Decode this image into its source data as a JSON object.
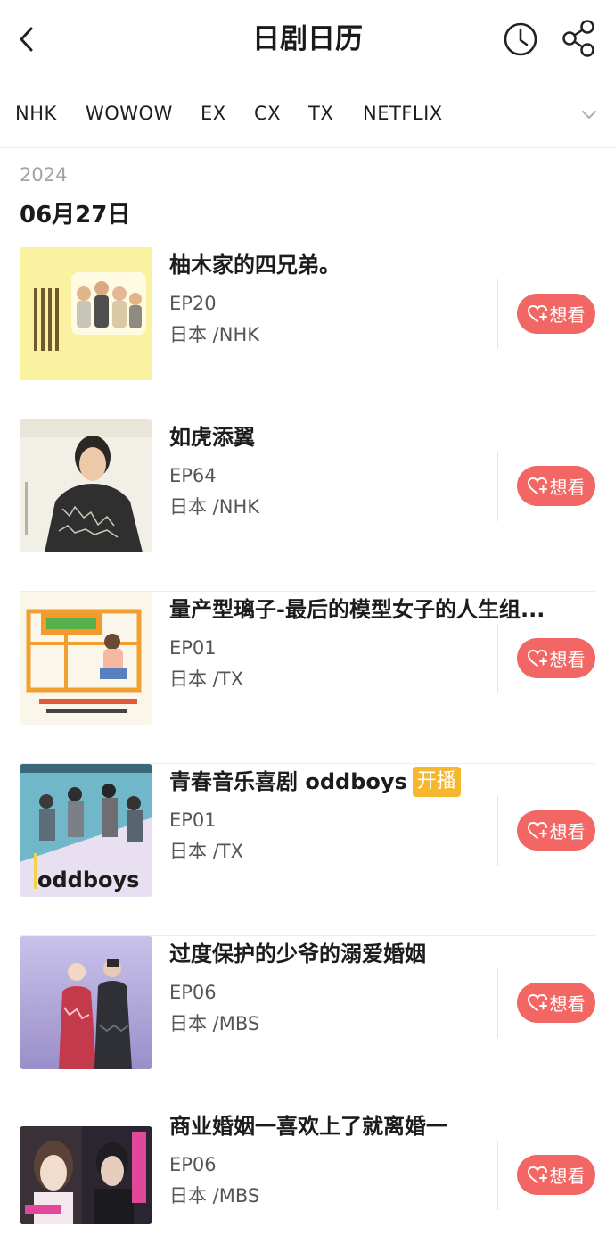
{
  "header": {
    "title": "日剧日历",
    "back_icon": "chevron-left-icon",
    "history_icon": "clock-icon",
    "share_icon": "share-icon"
  },
  "tabs": [
    {
      "label": "NHK"
    },
    {
      "label": "WOWOW"
    },
    {
      "label": "EX"
    },
    {
      "label": "CX"
    },
    {
      "label": "TX"
    },
    {
      "label": "NETFLIX"
    }
  ],
  "tabs_more_icon": "chevron-down-icon",
  "section": {
    "year": "2024",
    "date": "06月27日"
  },
  "want_label": "想看",
  "badge_label": "开播",
  "colors": {
    "accent": "#f26663",
    "badge": "#f6b72f"
  },
  "items": [
    {
      "title": "柚木家的四兄弟。",
      "ep": "EP20",
      "region": "日本 /NHK",
      "badge": false
    },
    {
      "title": "如虎添翼",
      "ep": "EP64",
      "region": "日本 /NHK",
      "badge": false
    },
    {
      "title": "量产型璃子-最后的模型女子的人生组...",
      "ep": "EP01",
      "region": "日本 /TX",
      "badge": false
    },
    {
      "title": "青春音乐喜剧 oddboys",
      "ep": "EP01",
      "region": "日本 /TX",
      "badge": true
    },
    {
      "title": "过度保护的少爷的溺爱婚姻",
      "ep": "EP06",
      "region": "日本 /MBS",
      "badge": false
    },
    {
      "title": "商业婚姻一喜欢上了就离婚一",
      "ep": "EP06",
      "region": "日本 /MBS",
      "badge": false
    }
  ]
}
